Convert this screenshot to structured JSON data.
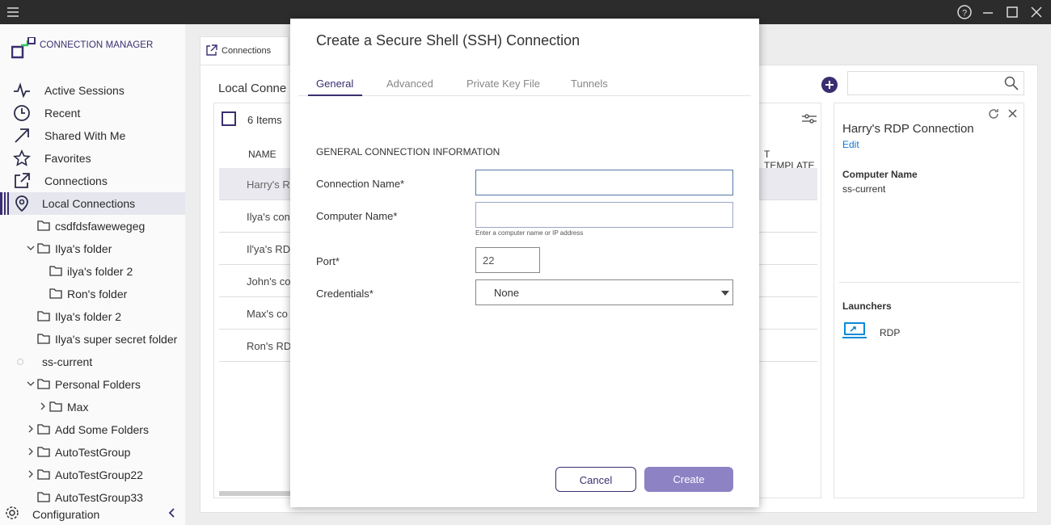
{
  "sidebar": {
    "logo_text": "CONNECTION MANAGER",
    "nav": [
      {
        "label": "Active Sessions",
        "icon": "activity-icon"
      },
      {
        "label": "Recent",
        "icon": "clock-icon"
      },
      {
        "label": "Shared With Me",
        "icon": "share-arrow-icon"
      },
      {
        "label": "Favorites",
        "icon": "star-icon"
      },
      {
        "label": "Connections",
        "icon": "external-link-icon"
      },
      {
        "label": "Local Connections",
        "icon": "location-pin-icon"
      }
    ],
    "tree": [
      {
        "label": "csdfdsfawewegeg"
      },
      {
        "label": "Ilya's folder"
      },
      {
        "label": "ilya's folder 2"
      },
      {
        "label": "Ron's folder"
      },
      {
        "label": "Ilya's folder 2"
      },
      {
        "label": "Ilya's super secret folder"
      },
      {
        "label": "ss-current"
      },
      {
        "label": "Personal Folders"
      },
      {
        "label": "Max"
      },
      {
        "label": "Add Some Folders"
      },
      {
        "label": "AutoTestGroup"
      },
      {
        "label": "AutoTestGroup22"
      },
      {
        "label": "AutoTestGroup33"
      }
    ],
    "configuration": "Configuration"
  },
  "main": {
    "tab_label": "Connections",
    "panel_title": "Local Conne",
    "items_count": "6 Items",
    "col_name": "NAME",
    "col_template": "T TEMPLATE",
    "rows": [
      "Harry's R",
      "Ilya's con",
      "Il'ya's RDP",
      "John's co",
      "Max's co",
      "Ron's RDP"
    ]
  },
  "details": {
    "title": "Harry's RDP Connection",
    "edit": "Edit",
    "computer_name_label": "Computer Name",
    "computer_name_value": "ss-current",
    "launchers_label": "Launchers",
    "launcher_rdp": "RDP"
  },
  "dialog": {
    "title": "Create a Secure Shell (SSH) Connection",
    "tabs": [
      "General",
      "Advanced",
      "Private Key File",
      "Tunnels"
    ],
    "section": "GENERAL CONNECTION INFORMATION",
    "connection_name_label": "Connection Name*",
    "connection_name_value": "",
    "computer_name_label": "Computer Name*",
    "computer_name_value": "",
    "computer_name_hint": "Enter a computer name or IP address",
    "port_label": "Port*",
    "port_value": "22",
    "credentials_label": "Credentials*",
    "credentials_value": "None",
    "cancel": "Cancel",
    "create": "Create"
  },
  "colors": {
    "accent": "#3a2e70",
    "create_btn": "#8c82c4",
    "link": "#0a78d7"
  }
}
